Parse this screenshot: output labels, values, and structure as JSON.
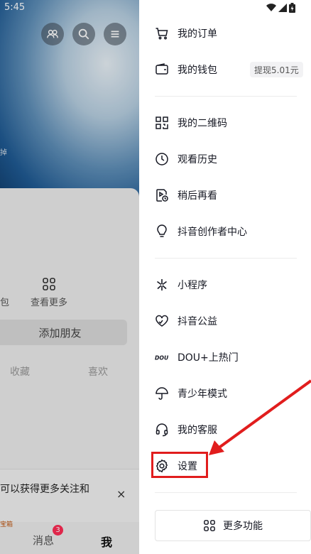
{
  "status_bar": {
    "time": "5:45"
  },
  "left_panel": {
    "side_mark": "掉",
    "more_label": "查看更多",
    "partial_label": "包",
    "add_friend": "添加朋友",
    "tabs": [
      "收藏",
      "喜欢"
    ],
    "tip_text": "可以获得更多关注和",
    "tip_close": "×",
    "tip_tag": "宝箱",
    "nav": {
      "messages": "消息",
      "messages_badge": "3",
      "me": "我"
    }
  },
  "drawer": {
    "items": [
      {
        "label": "我的订单",
        "icon": "cart-icon"
      },
      {
        "label": "我的钱包",
        "icon": "wallet-icon"
      },
      {
        "label": "我的二维码",
        "icon": "qrcode-icon"
      },
      {
        "label": "观看历史",
        "icon": "clock-icon"
      },
      {
        "label": "稍后再看",
        "icon": "watch-later-icon"
      },
      {
        "label": "抖音创作者中心",
        "icon": "bulb-icon"
      },
      {
        "label": "小程序",
        "icon": "asterisk-icon"
      },
      {
        "label": "抖音公益",
        "icon": "heart-hands-icon"
      },
      {
        "label": "DOU+上热门",
        "icon": "dou-icon"
      },
      {
        "label": "青少年模式",
        "icon": "umbrella-icon"
      },
      {
        "label": "我的客服",
        "icon": "headset-icon"
      },
      {
        "label": "设置",
        "icon": "gear-icon"
      }
    ],
    "wallet_withdraw": "提现5.01元",
    "more_functions": "更多功能"
  },
  "colors": {
    "highlight": "#e11d1d",
    "badge": "#fe2c55"
  }
}
